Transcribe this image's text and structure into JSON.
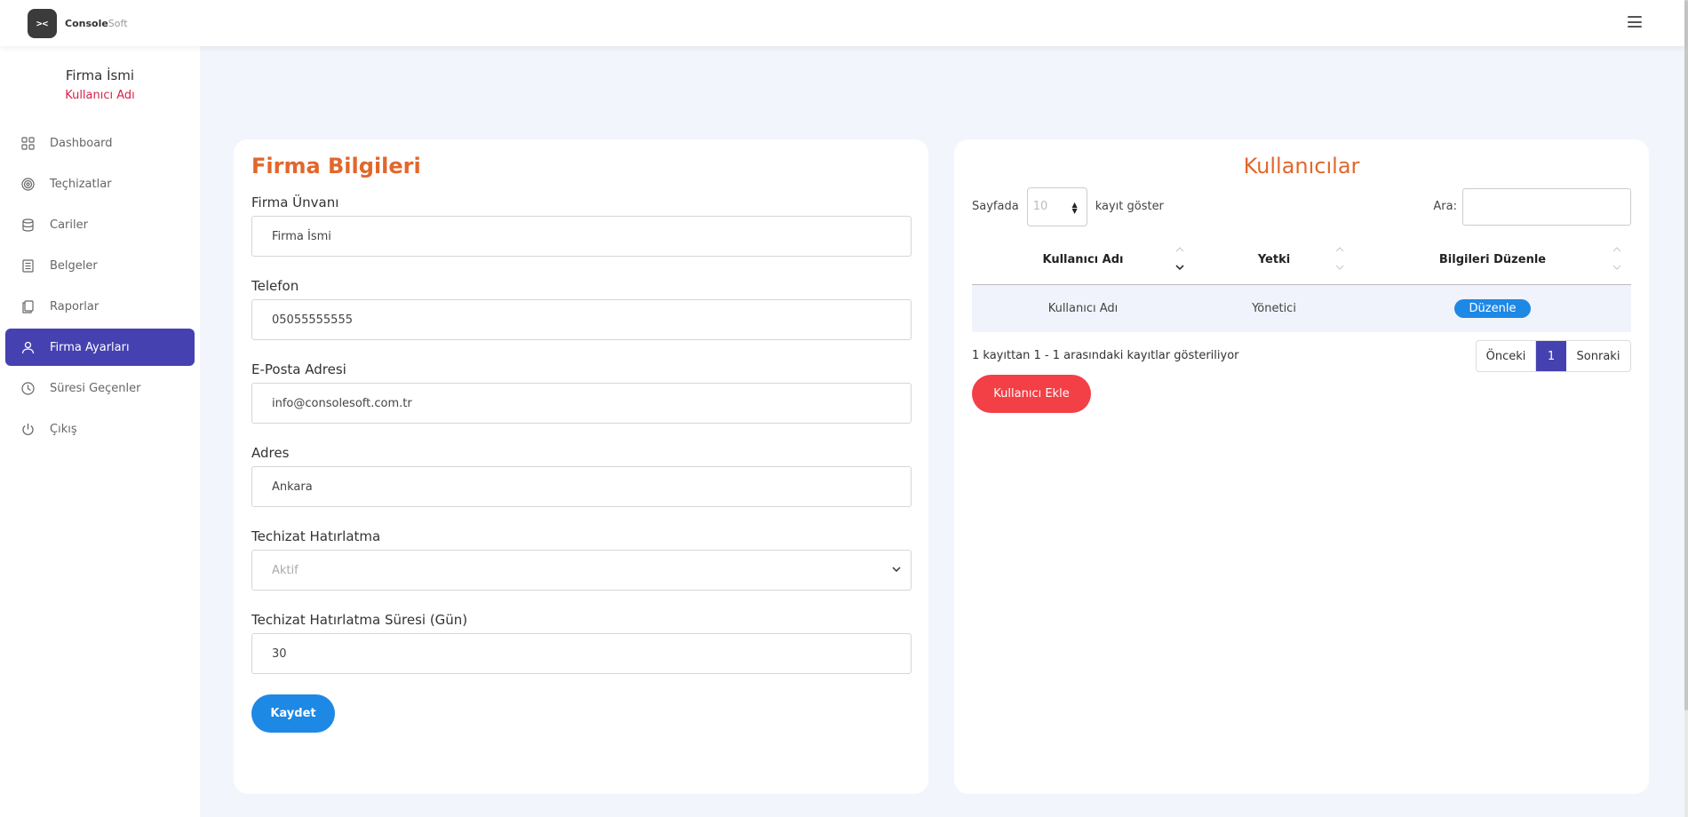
{
  "brand": {
    "mark": "><",
    "name_bold": "Console",
    "name_light": "Soft"
  },
  "sidebar": {
    "firm_name": "Firma İsmi",
    "user_name": "Kullanıcı Adı",
    "items": [
      {
        "label": "Dashboard",
        "icon": "grid-icon"
      },
      {
        "label": "Teçhizatlar",
        "icon": "target-icon"
      },
      {
        "label": "Cariler",
        "icon": "database-icon"
      },
      {
        "label": "Belgeler",
        "icon": "document-icon"
      },
      {
        "label": "Raporlar",
        "icon": "copy-icon"
      },
      {
        "label": "Firma Ayarları",
        "icon": "user-icon",
        "active": true
      },
      {
        "label": "Süresi Geçenler",
        "icon": "clock-icon"
      },
      {
        "label": "Çıkış",
        "icon": "power-icon"
      }
    ]
  },
  "form": {
    "title": "Firma Bilgileri",
    "fields": [
      {
        "label": "Firma Ünvanı",
        "value": "Firma İsmi"
      },
      {
        "label": "Telefon",
        "value": "05055555555"
      },
      {
        "label": "E-Posta Adresi",
        "value": "info@consolesoft.com.tr"
      },
      {
        "label": "Adres",
        "value": "Ankara"
      },
      {
        "label": "Techizat Hatırlatma",
        "value": "Aktif",
        "type": "select"
      },
      {
        "label": "Techizat Hatırlatma Süresi (Gün)",
        "value": "30"
      }
    ],
    "save_label": "Kaydet"
  },
  "users": {
    "title": "Kullanıcılar",
    "length_prefix": "Sayfada",
    "length_value": "10",
    "length_suffix": "kayıt göster",
    "search_label": "Ara:",
    "columns": [
      "Kullanıcı Adı",
      "Yetki",
      "Bilgileri Düzenle"
    ],
    "rows": [
      {
        "name": "Kullanıcı Adı",
        "role": "Yönetici",
        "action": "Düzenle"
      }
    ],
    "info": "1 kayıttan 1 - 1 arasındaki kayıtlar gösteriliyor",
    "pager": {
      "prev": "Önceki",
      "current": "1",
      "next": "Sonraki"
    },
    "add_label": "Kullanıcı Ekle"
  },
  "colors": {
    "accent": "#4541b0",
    "title": "#e2672b",
    "primary_button": "#1e88e5",
    "danger_button": "#f33f46",
    "user_name": "#d8204a"
  }
}
